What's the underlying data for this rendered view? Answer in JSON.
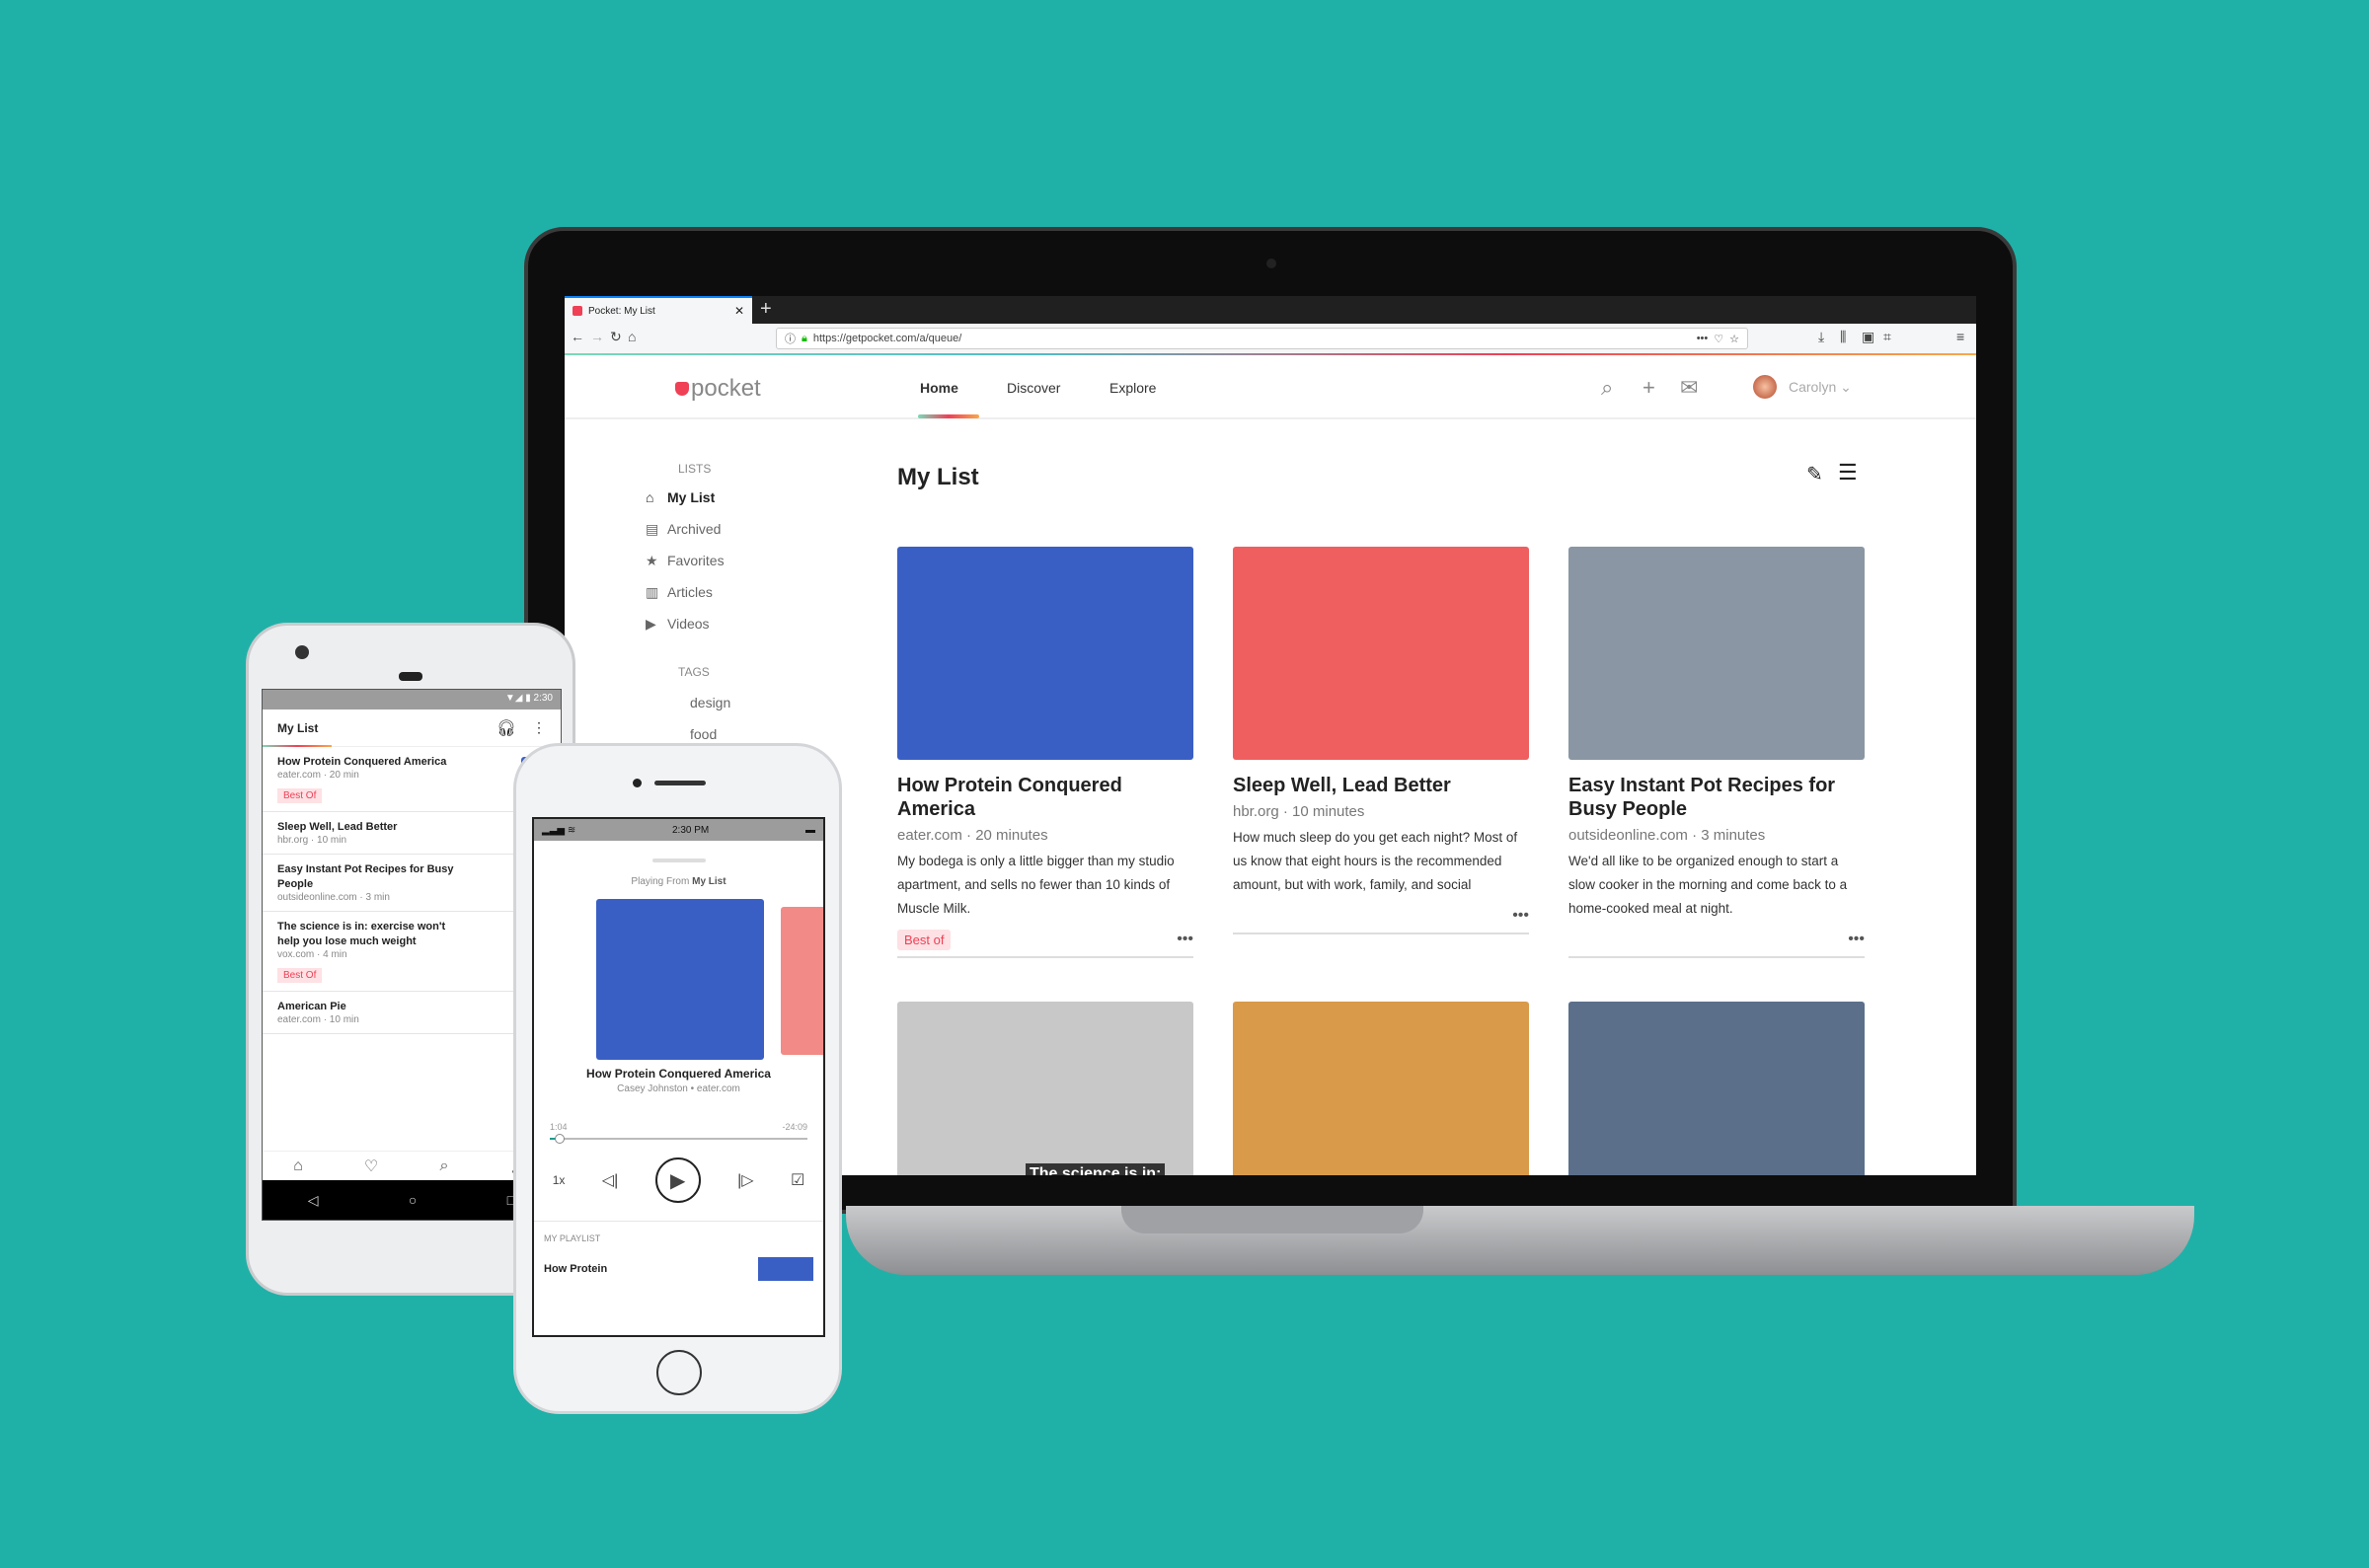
{
  "browser": {
    "tab_title": "Pocket: My List",
    "url": "https://getpocket.com/a/queue/"
  },
  "header": {
    "logo": "pocket",
    "nav": [
      "Home",
      "Discover",
      "Explore"
    ],
    "active_nav": "Home",
    "user": "Carolyn"
  },
  "sidebar": {
    "lists_heading": "LISTS",
    "lists": [
      {
        "label": "My List",
        "icon": "home-icon"
      },
      {
        "label": "Archived",
        "icon": "archive-icon"
      },
      {
        "label": "Favorites",
        "icon": "star-icon"
      },
      {
        "label": "Articles",
        "icon": "article-icon"
      },
      {
        "label": "Videos",
        "icon": "video-icon"
      }
    ],
    "tags_heading": "TAGS",
    "tags": [
      "design",
      "food"
    ]
  },
  "main": {
    "title": "My List",
    "cards": [
      {
        "title": "How Protein Conquered America",
        "meta": "eater.com · 20 minutes",
        "excerpt": "My bodega is only a little bigger than my studio apartment, and sells no fewer than 10 kinds of Muscle Milk.",
        "badge": "Best of",
        "color": "#3a5fc4"
      },
      {
        "title": "Sleep Well, Lead Better",
        "meta": "hbr.org · 10 minutes",
        "excerpt": "How much sleep do you get each night? Most of us know that eight hours is the recommended amount, but with work, family, and social commitments often consuming",
        "badge": "",
        "color": "#ef5f5f"
      },
      {
        "title": "Easy Instant Pot Recipes for Busy People",
        "meta": "outsideonline.com · 3 minutes",
        "excerpt": "We'd all like to be organized enough to start a slow cooker in the morning and come back to a home-cooked meal at night.",
        "badge": "",
        "color": "#8a96a3"
      }
    ],
    "row2": [
      {
        "caption": "The science is in:",
        "color": "#c8c8c8"
      },
      {
        "caption": "",
        "color": "#d99a4a"
      },
      {
        "caption": "",
        "color": "#5b6f8a"
      }
    ]
  },
  "android": {
    "time": "2:30",
    "title": "My List",
    "items": [
      {
        "title": "How Protein Conquered America",
        "meta": "eater.com · 20 min",
        "badge": "Best Of",
        "color": "#3a5fc4"
      },
      {
        "title": "Sleep Well, Lead Better",
        "meta": "hbr.org · 10 min",
        "badge": "",
        "color": "#ef5f5f"
      },
      {
        "title": "Easy Instant Pot Recipes for Busy People",
        "meta": "outsideonline.com · 3 min",
        "badge": "",
        "color": "#8a96a3"
      },
      {
        "title": "The science is in: exercise won't help you lose much weight",
        "meta": "vox.com · 4 min",
        "badge": "Best Of",
        "color": "#ddd"
      },
      {
        "title": "American Pie",
        "meta": "eater.com · 10 min",
        "badge": "",
        "color": "#e96a2a"
      }
    ]
  },
  "iphone": {
    "time": "2:30 PM",
    "playing_prefix": "Playing From",
    "playing_list": "My List",
    "title": "How Protein Conquered America",
    "byline": "Casey Johnston • eater.com",
    "elapsed": "1:04",
    "remaining": "-24:09",
    "progress_percent": 4,
    "speed": "1x",
    "playlist_heading": "MY PLAYLIST",
    "playlist_item": "How Protein"
  },
  "colors": {
    "background": "#1fb1a8",
    "accent": "#ef4056"
  }
}
